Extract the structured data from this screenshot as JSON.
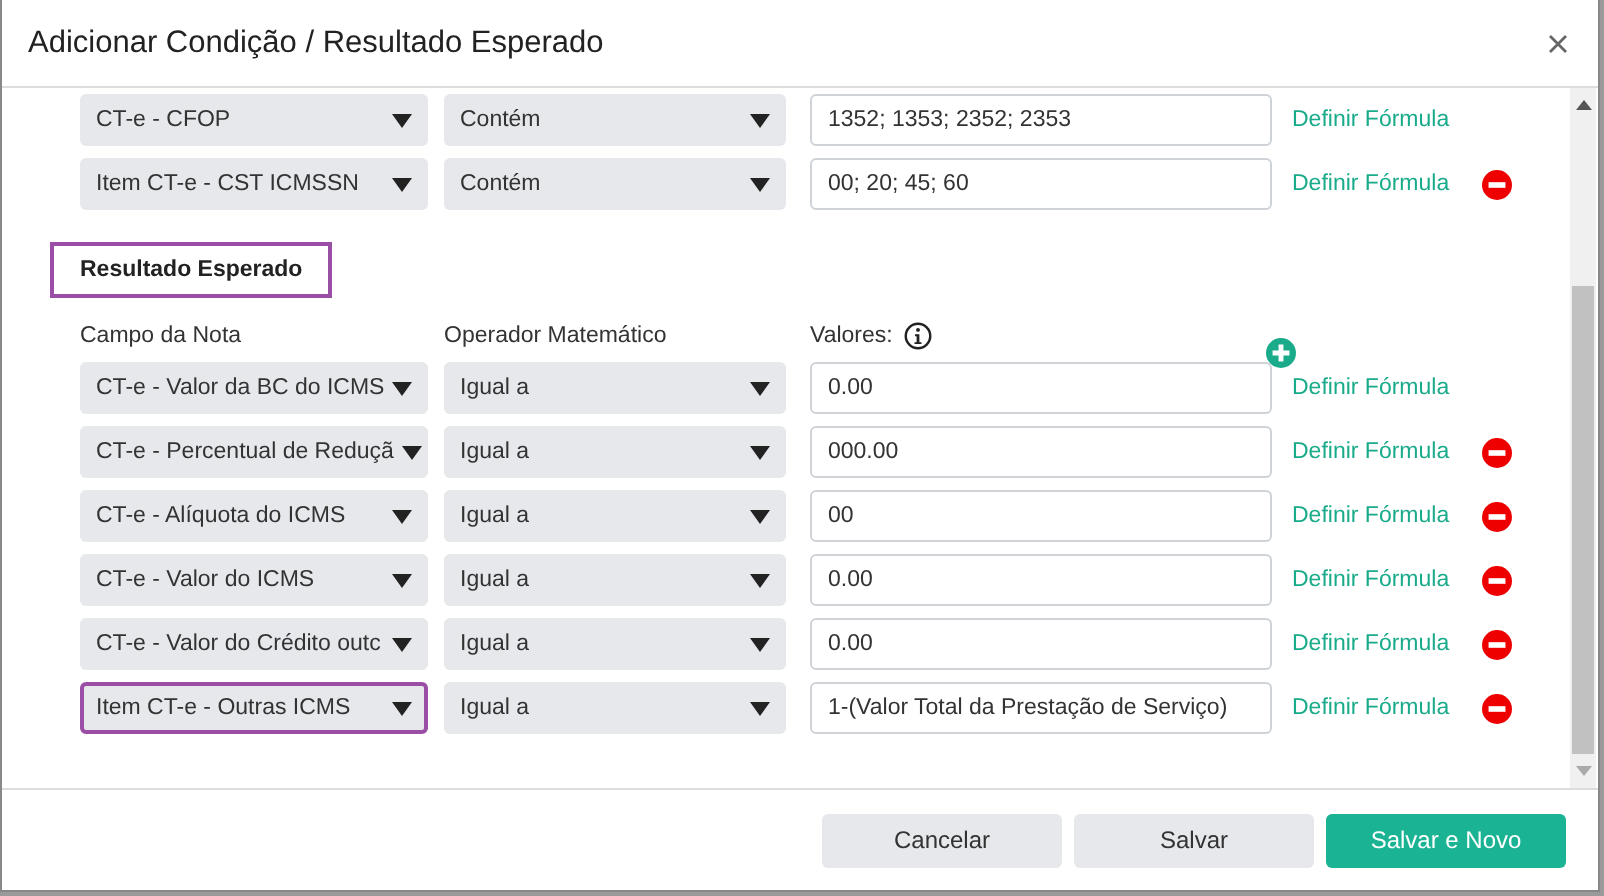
{
  "dialog": {
    "title": "Adicionar Condição / Resultado Esperado"
  },
  "conditions": [
    {
      "field": "CT-e - CFOP",
      "operator": "Contém",
      "value": "1352; 1353; 2352; 2353",
      "link": "Definir Fórmula",
      "removable": false,
      "highlighted": false
    },
    {
      "field": "Item CT-e - CST ICMSSN",
      "operator": "Contém",
      "value": "00; 20; 45; 60",
      "link": "Definir Fórmula",
      "removable": true,
      "highlighted": false
    }
  ],
  "result_section": {
    "title": "Resultado Esperado",
    "highlighted": true,
    "columns": [
      "Campo da Nota",
      "Operador Matemático",
      "Valores:"
    ],
    "rows": [
      {
        "field": "CT-e - Valor da BC do ICMS",
        "operator": "Igual a",
        "value": "0.00",
        "link": "Definir Fórmula",
        "removable": false,
        "highlighted": false
      },
      {
        "field": "CT-e - Percentual de Reduçã",
        "operator": "Igual a",
        "value": "000.00",
        "link": "Definir Fórmula",
        "removable": true,
        "highlighted": false
      },
      {
        "field": "CT-e - Alíquota do ICMS",
        "operator": "Igual a",
        "value": "00",
        "link": "Definir Fórmula",
        "removable": true,
        "highlighted": false
      },
      {
        "field": "CT-e - Valor do ICMS",
        "operator": "Igual a",
        "value": "0.00",
        "link": "Definir Fórmula",
        "removable": true,
        "highlighted": false
      },
      {
        "field": "CT-e - Valor do Crédito outc",
        "operator": "Igual a",
        "value": "0.00",
        "link": "Definir Fórmula",
        "removable": true,
        "highlighted": false
      },
      {
        "field": "Item CT-e - Outras ICMS",
        "operator": "Igual a",
        "value": "1-(Valor Total da Prestação de Serviço)",
        "link": "Definir Fórmula",
        "removable": true,
        "highlighted": true
      }
    ]
  },
  "footer": {
    "buttons": [
      {
        "label": "Cancelar",
        "kind": "secondary"
      },
      {
        "label": "Salvar",
        "kind": "secondary"
      },
      {
        "label": "Salvar e Novo",
        "kind": "primary"
      }
    ]
  }
}
